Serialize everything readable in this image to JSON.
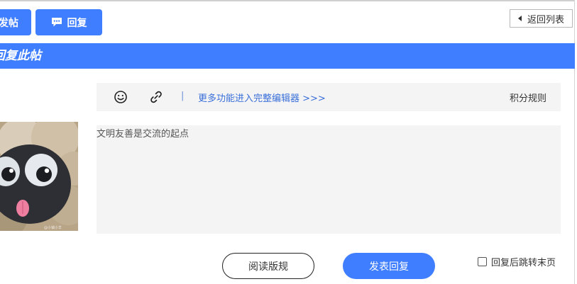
{
  "header": {
    "new_post_label": "发帖",
    "reply_label": "回复",
    "back_label": "返回列表"
  },
  "reply_section": {
    "title": "回复此帖"
  },
  "toolbar": {
    "icons": [
      "smiley-icon",
      "link-icon"
    ],
    "separator": "|",
    "full_editor_link": "更多功能进入完整编辑器 >>>",
    "score_rules": "积分规则"
  },
  "avatar": {
    "stamp_text": "@小镇小羊"
  },
  "editor": {
    "placeholder": "文明友善是交流的起点"
  },
  "actions": {
    "read_rules_label": "阅读版规",
    "submit_label": "发表回复",
    "jump_option_label": "回复后跳转末页",
    "jump_option_checked": false
  },
  "colors": {
    "accent": "#3e7eff",
    "link": "#3a6fd9",
    "panel_bg": "#f4f4f4"
  }
}
